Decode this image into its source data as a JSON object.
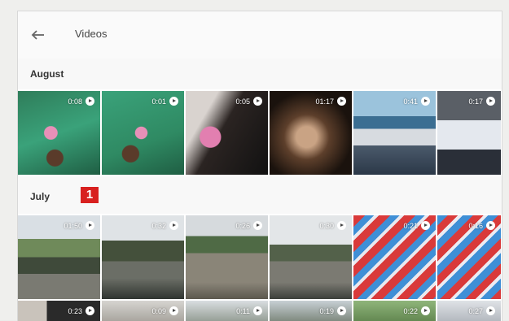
{
  "header": {
    "title": "Videos",
    "back_icon": "arrow-left-icon"
  },
  "sections": [
    {
      "label": "August",
      "videos": [
        {
          "duration": "0:08"
        },
        {
          "duration": "0:01"
        },
        {
          "duration": "0:05"
        },
        {
          "duration": "01:17"
        },
        {
          "duration": "0:41"
        },
        {
          "duration": "0:17"
        }
      ]
    },
    {
      "label": "July",
      "badge": "1",
      "videos": [
        {
          "duration": "01:50"
        },
        {
          "duration": "0:32"
        },
        {
          "duration": "0:26"
        },
        {
          "duration": "0:30"
        },
        {
          "duration": "0:21"
        },
        {
          "duration": "0:16"
        }
      ]
    },
    {
      "label": "",
      "videos": [
        {
          "duration": "0:23"
        },
        {
          "duration": "0:09"
        },
        {
          "duration": "0:11"
        },
        {
          "duration": "0:19"
        },
        {
          "duration": "0:22"
        },
        {
          "duration": "0:27"
        }
      ]
    }
  ],
  "colors": {
    "badge": "#d8201f",
    "background": "#ffffff"
  }
}
